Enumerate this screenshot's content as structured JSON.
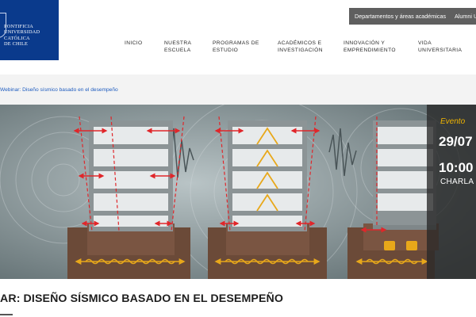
{
  "logo": {
    "lines": [
      "PONTIFICIA",
      "UNIVERSIDAD",
      "CATÓLICA",
      "DE CHILE"
    ]
  },
  "topbar": {
    "departments": "Departamentos y áreas académicas",
    "alumni": "Alumni UC"
  },
  "nav": [
    {
      "lines": [
        "INICIO"
      ]
    },
    {
      "lines": [
        "NUESTRA",
        "ESCUELA"
      ]
    },
    {
      "lines": [
        "PROGRAMAS DE",
        "ESTUDIO"
      ]
    },
    {
      "lines": [
        "ACADÉMICOS E",
        "INVESTIGACIÓN"
      ]
    },
    {
      "lines": [
        "INNOVACIÓN Y",
        "EMPRENDIMIENTO"
      ]
    },
    {
      "lines": [
        "VIDA",
        "UNIVERSITARIA"
      ]
    }
  ],
  "breadcrumb": "Webinar: Diseño sísmico basado en el desempeño",
  "event": {
    "label": "Evento",
    "date": "29/07",
    "time": "10:00",
    "type": "CHARLA"
  },
  "page_title": "AR: DISEÑO SÍSMICO BASADO EN EL DESEMPEÑO",
  "colors": {
    "brand_blue": "#0a3a8c",
    "link_blue": "#1d5bbf",
    "event_accent": "#f0b400",
    "damper_orange": "#e8a81a",
    "ground_brown": "#6b4a38",
    "arrow_red": "#e0262a"
  }
}
